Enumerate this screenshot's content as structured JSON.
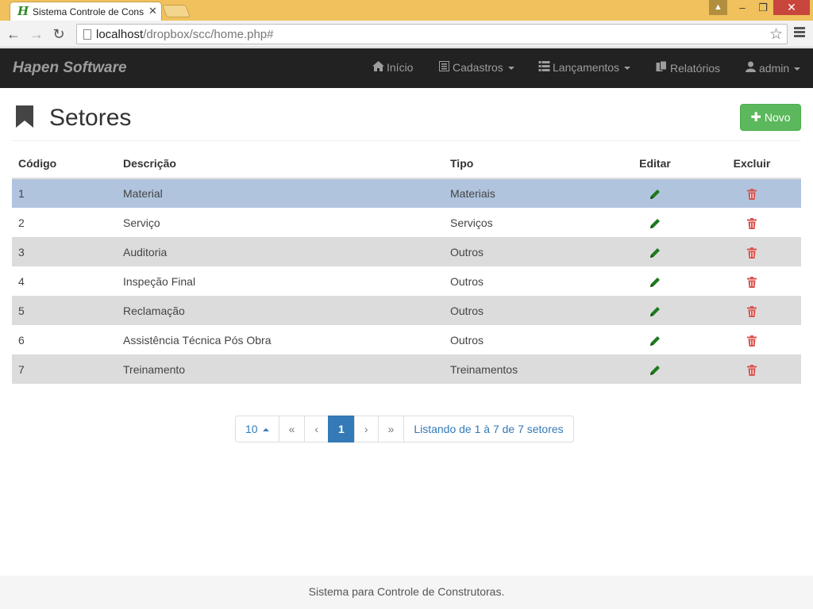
{
  "browser": {
    "tab_title": "Sistema Controle de Cons",
    "url_host": "localhost",
    "url_path": "/dropbox/scc/home.php#"
  },
  "navbar": {
    "brand": "Hapen Software",
    "items": [
      {
        "label": "Início",
        "icon": "home-icon"
      },
      {
        "label": "Cadastros",
        "icon": "list-alt-icon",
        "dropdown": true
      },
      {
        "label": "Lançamentos",
        "icon": "th-list-icon",
        "dropdown": true
      },
      {
        "label": "Relatórios",
        "icon": "files-icon"
      },
      {
        "label": "admin",
        "icon": "user-icon",
        "dropdown": true
      }
    ]
  },
  "page": {
    "title": "Setores",
    "new_button": "Novo"
  },
  "table": {
    "headers": {
      "code": "Código",
      "desc": "Descrição",
      "tipo": "Tipo",
      "edit": "Editar",
      "delete": "Excluir"
    },
    "rows": [
      {
        "code": "1",
        "desc": "Material",
        "tipo": "Materiais"
      },
      {
        "code": "2",
        "desc": "Serviço",
        "tipo": "Serviços"
      },
      {
        "code": "3",
        "desc": "Auditoria",
        "tipo": "Outros"
      },
      {
        "code": "4",
        "desc": "Inspeção Final",
        "tipo": "Outros"
      },
      {
        "code": "5",
        "desc": "Reclamação",
        "tipo": "Outros"
      },
      {
        "code": "6",
        "desc": "Assistência Técnica Pós Obra",
        "tipo": "Outros"
      },
      {
        "code": "7",
        "desc": "Treinamento",
        "tipo": "Treinamentos"
      }
    ],
    "selected_row": 1
  },
  "pagination": {
    "page_size": "10",
    "first": "«",
    "prev": "‹",
    "current": "1",
    "next": "›",
    "last": "»",
    "summary": "Listando de 1 à 7 de 7 setores"
  },
  "footer": {
    "text": "Sistema para Controle de Construtoras."
  },
  "colors": {
    "navbar_bg": "#222222",
    "primary": "#337ab7",
    "success": "#5cb85c",
    "edit_icon": "#1e7a1e",
    "delete_icon": "#d9534f",
    "selected_row": "#b0c4de"
  }
}
